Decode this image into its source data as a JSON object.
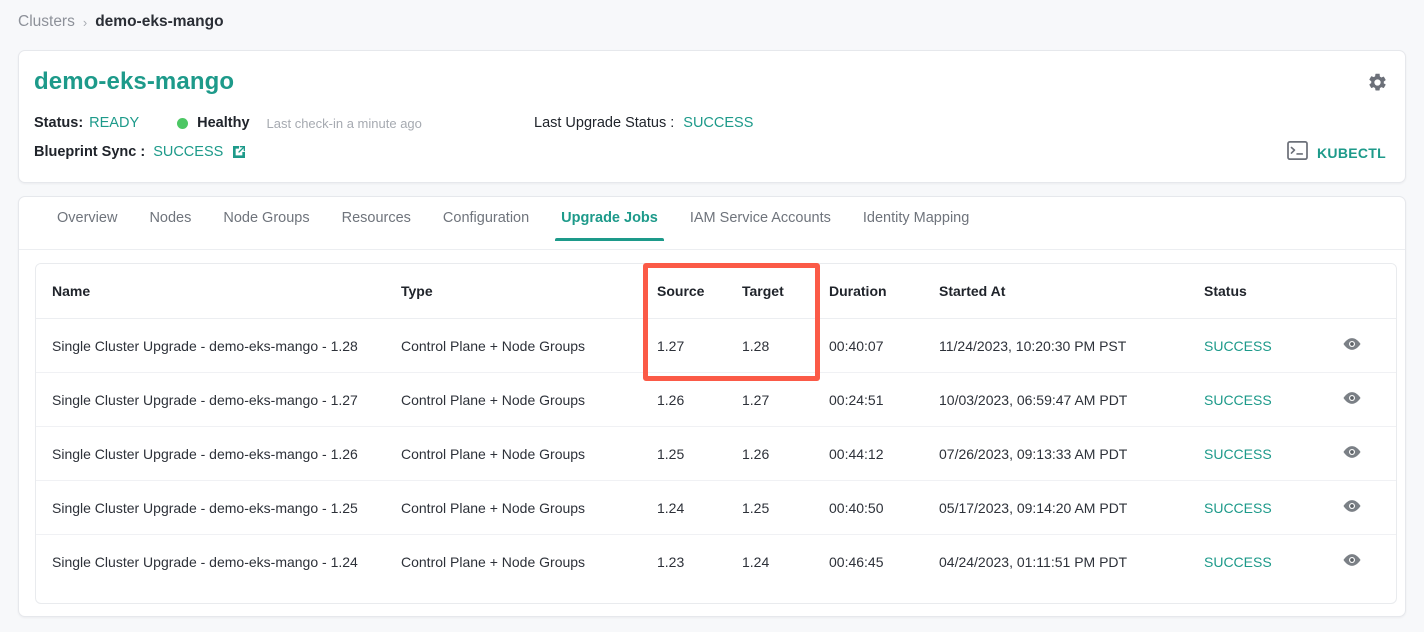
{
  "breadcrumb": {
    "root": "Clusters",
    "separator": "›",
    "current": "demo-eks-mango"
  },
  "header": {
    "cluster_name": "demo-eks-mango",
    "status_label": "Status:",
    "status_value": "READY",
    "health_value": "Healthy",
    "health_dot_color": "#4cc764",
    "last_checkin": "Last check-in a minute ago",
    "blueprint_sync_label": "Blueprint Sync :",
    "blueprint_sync_value": "SUCCESS",
    "last_upgrade_label": "Last Upgrade Status :",
    "last_upgrade_value": "SUCCESS",
    "kubectl_label": "KUBECTL",
    "gear_icon": "gear-icon",
    "external_link_icon": "external-link-icon",
    "terminal_icon": "terminal-icon",
    "accent_color": "#1d9a8a"
  },
  "tabs": [
    {
      "label": "Overview",
      "active": false
    },
    {
      "label": "Nodes",
      "active": false
    },
    {
      "label": "Node Groups",
      "active": false
    },
    {
      "label": "Resources",
      "active": false
    },
    {
      "label": "Configuration",
      "active": false
    },
    {
      "label": "Upgrade Jobs",
      "active": true
    },
    {
      "label": "IAM Service Accounts",
      "active": false
    },
    {
      "label": "Identity Mapping",
      "active": false
    }
  ],
  "table": {
    "columns": [
      "Name",
      "Type",
      "Source",
      "Target",
      "Duration",
      "Started At",
      "Status",
      ""
    ],
    "rows": [
      {
        "name": "Single Cluster Upgrade - demo-eks-mango - 1.28",
        "type": "Control Plane + Node Groups",
        "source": "1.27",
        "target": "1.28",
        "duration": "00:40:07",
        "started_at": "11/24/2023, 10:20:30 PM PST",
        "status": "SUCCESS",
        "action_icon": "eye-icon"
      },
      {
        "name": "Single Cluster Upgrade - demo-eks-mango - 1.27",
        "type": "Control Plane + Node Groups",
        "source": "1.26",
        "target": "1.27",
        "duration": "00:24:51",
        "started_at": "10/03/2023, 06:59:47 AM PDT",
        "status": "SUCCESS",
        "action_icon": "eye-icon"
      },
      {
        "name": "Single Cluster Upgrade - demo-eks-mango - 1.26",
        "type": "Control Plane + Node Groups",
        "source": "1.25",
        "target": "1.26",
        "duration": "00:44:12",
        "started_at": "07/26/2023, 09:13:33 AM PDT",
        "status": "SUCCESS",
        "action_icon": "eye-icon"
      },
      {
        "name": "Single Cluster Upgrade - demo-eks-mango - 1.25",
        "type": "Control Plane + Node Groups",
        "source": "1.24",
        "target": "1.25",
        "duration": "00:40:50",
        "started_at": "05/17/2023, 09:14:20 AM PDT",
        "status": "SUCCESS",
        "action_icon": "eye-icon"
      },
      {
        "name": "Single Cluster Upgrade - demo-eks-mango - 1.24",
        "type": "Control Plane + Node Groups",
        "source": "1.23",
        "target": "1.24",
        "duration": "00:46:45",
        "started_at": "04/24/2023, 01:11:51 PM PDT",
        "status": "SUCCESS",
        "action_icon": "eye-icon"
      }
    ]
  },
  "annotation": {
    "highlight_color": "#fb5a47",
    "highlights_columns": [
      "Source",
      "Target"
    ]
  }
}
